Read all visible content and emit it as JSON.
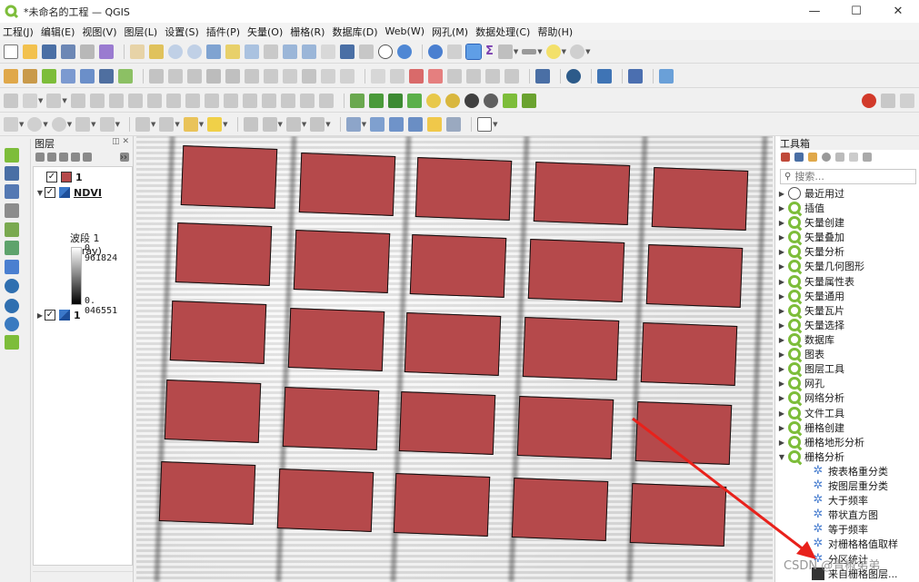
{
  "window": {
    "title": "*未命名的工程 — QGIS",
    "controls": {
      "minimize": "—",
      "maximize": "☐",
      "close": "✕"
    }
  },
  "menu": [
    "工程(J)",
    "编辑(E)",
    "视图(V)",
    "图层(L)",
    "设置(S)",
    "插件(P)",
    "矢量(O)",
    "栅格(R)",
    "数据库(D)",
    "Web(W)",
    "网孔(M)",
    "数据处理(C)",
    "帮助(H)"
  ],
  "layers_panel": {
    "title": "图层",
    "more_chevron": "››",
    "layers": [
      {
        "name": "1",
        "checked": true,
        "type": "vector",
        "color": "#b5494b"
      },
      {
        "name": "NDVI",
        "checked": true,
        "type": "raster",
        "expanded": true
      },
      {
        "name": "1",
        "checked": true,
        "type": "raster",
        "expanded": false
      }
    ],
    "legend": {
      "band": "波段 1 (Gray)",
      "max": "0. 961824",
      "min": "0. 046551"
    }
  },
  "toolbox": {
    "title": "工具箱",
    "search_placeholder": "搜索...",
    "items": [
      {
        "label": "最近用过",
        "icon": "clock-icon",
        "expanded": false
      },
      {
        "label": "插值",
        "icon": "qgis-icon",
        "expanded": false
      },
      {
        "label": "矢量创建",
        "icon": "qgis-icon",
        "expanded": false
      },
      {
        "label": "矢量叠加",
        "icon": "qgis-icon",
        "expanded": false
      },
      {
        "label": "矢量分析",
        "icon": "qgis-icon",
        "expanded": false
      },
      {
        "label": "矢量几何图形",
        "icon": "qgis-icon",
        "expanded": false
      },
      {
        "label": "矢量属性表",
        "icon": "qgis-icon",
        "expanded": false
      },
      {
        "label": "矢量通用",
        "icon": "qgis-icon",
        "expanded": false
      },
      {
        "label": "矢量瓦片",
        "icon": "qgis-icon",
        "expanded": false
      },
      {
        "label": "矢量选择",
        "icon": "qgis-icon",
        "expanded": false
      },
      {
        "label": "数据库",
        "icon": "qgis-icon",
        "expanded": false
      },
      {
        "label": "图表",
        "icon": "qgis-icon",
        "expanded": false
      },
      {
        "label": "图层工具",
        "icon": "qgis-icon",
        "expanded": false
      },
      {
        "label": "网孔",
        "icon": "qgis-icon",
        "expanded": false
      },
      {
        "label": "网络分析",
        "icon": "qgis-icon",
        "expanded": false
      },
      {
        "label": "文件工具",
        "icon": "qgis-icon",
        "expanded": false
      },
      {
        "label": "栅格创建",
        "icon": "qgis-icon",
        "expanded": false
      },
      {
        "label": "栅格地形分析",
        "icon": "qgis-icon",
        "expanded": false
      },
      {
        "label": "栅格分析",
        "icon": "qgis-icon",
        "expanded": true
      }
    ],
    "raster_analysis_children": [
      {
        "label": "按表格重分类",
        "icon": "gear-icon"
      },
      {
        "label": "按图层重分类",
        "icon": "gear-icon"
      },
      {
        "label": "大于频率",
        "icon": "gear-icon"
      },
      {
        "label": "带状直方图",
        "icon": "gear-icon"
      },
      {
        "label": "等于频率",
        "icon": "gear-icon"
      },
      {
        "label": "对栅格格值取样",
        "icon": "gear-icon"
      },
      {
        "label": "分区统计",
        "icon": "gear-icon"
      },
      {
        "label": "来自栅格图层...",
        "icon": "raster-icon"
      }
    ]
  },
  "map": {
    "plot_color": "#b5494b",
    "plot_rows": 5,
    "plot_cols": 5
  },
  "annotation": {
    "color": "#e8211b"
  },
  "watermark": "CSDN @青椒弟弟"
}
